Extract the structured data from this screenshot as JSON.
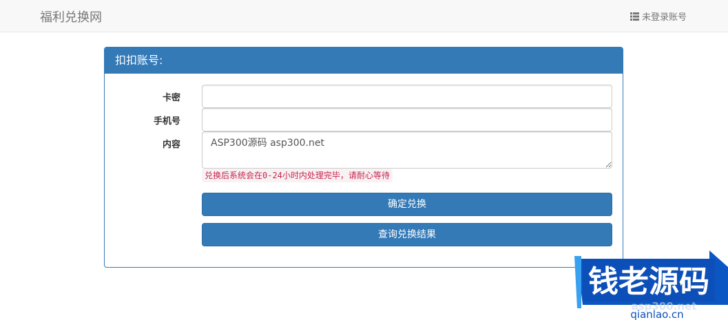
{
  "navbar": {
    "brand": "福利兑换网",
    "account_label": "未登录账号",
    "account_icon": "list-icon"
  },
  "panel": {
    "title": "扣扣账号:",
    "fields": {
      "card_label": "卡密",
      "card_value": "",
      "phone_label": "手机号",
      "phone_value": "",
      "content_label": "内容",
      "content_value": "ASP300源码 asp300.net"
    },
    "help_text": "兑换后系统会在0-24小时内处理完毕，请耐心等待",
    "confirm_button": "确定兑换",
    "query_button": "查询兑换结果"
  },
  "watermark": {
    "title": "钱老源码",
    "domain": "qianlao.cn",
    "faded": "asp300.net"
  },
  "colors": {
    "primary": "#337ab7",
    "help_text": "#c7254e",
    "help_bg": "#f9f2f4",
    "navbar_bg": "#f8f8f8"
  }
}
